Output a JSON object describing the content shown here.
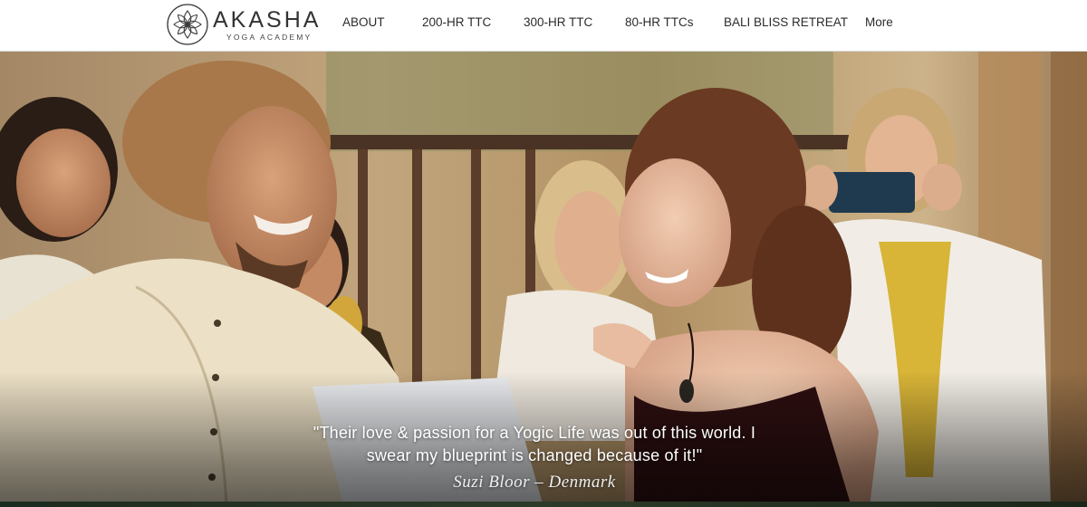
{
  "header": {
    "logo": {
      "name": "AKASHA",
      "subtitle": "YOGA ACADEMY"
    },
    "nav": [
      {
        "label": "ABOUT"
      },
      {
        "label": "200-HR TTC"
      },
      {
        "label": "300-HR TTC"
      },
      {
        "label": "80-HR TTCs"
      },
      {
        "label": "BALI BLISS RETREAT"
      },
      {
        "label": "More"
      }
    ]
  },
  "hero": {
    "quote_line1": "\"Their love & passion for a Yogic Life was out of this world. I",
    "quote_line2": "swear my blueprint is changed because of it!\"",
    "author": "Suzi Bloor – Denmark"
  },
  "colors": {
    "header_bg": "#ffffff",
    "nav_text": "#2b2b2b",
    "quote_text": "#ffffff"
  }
}
